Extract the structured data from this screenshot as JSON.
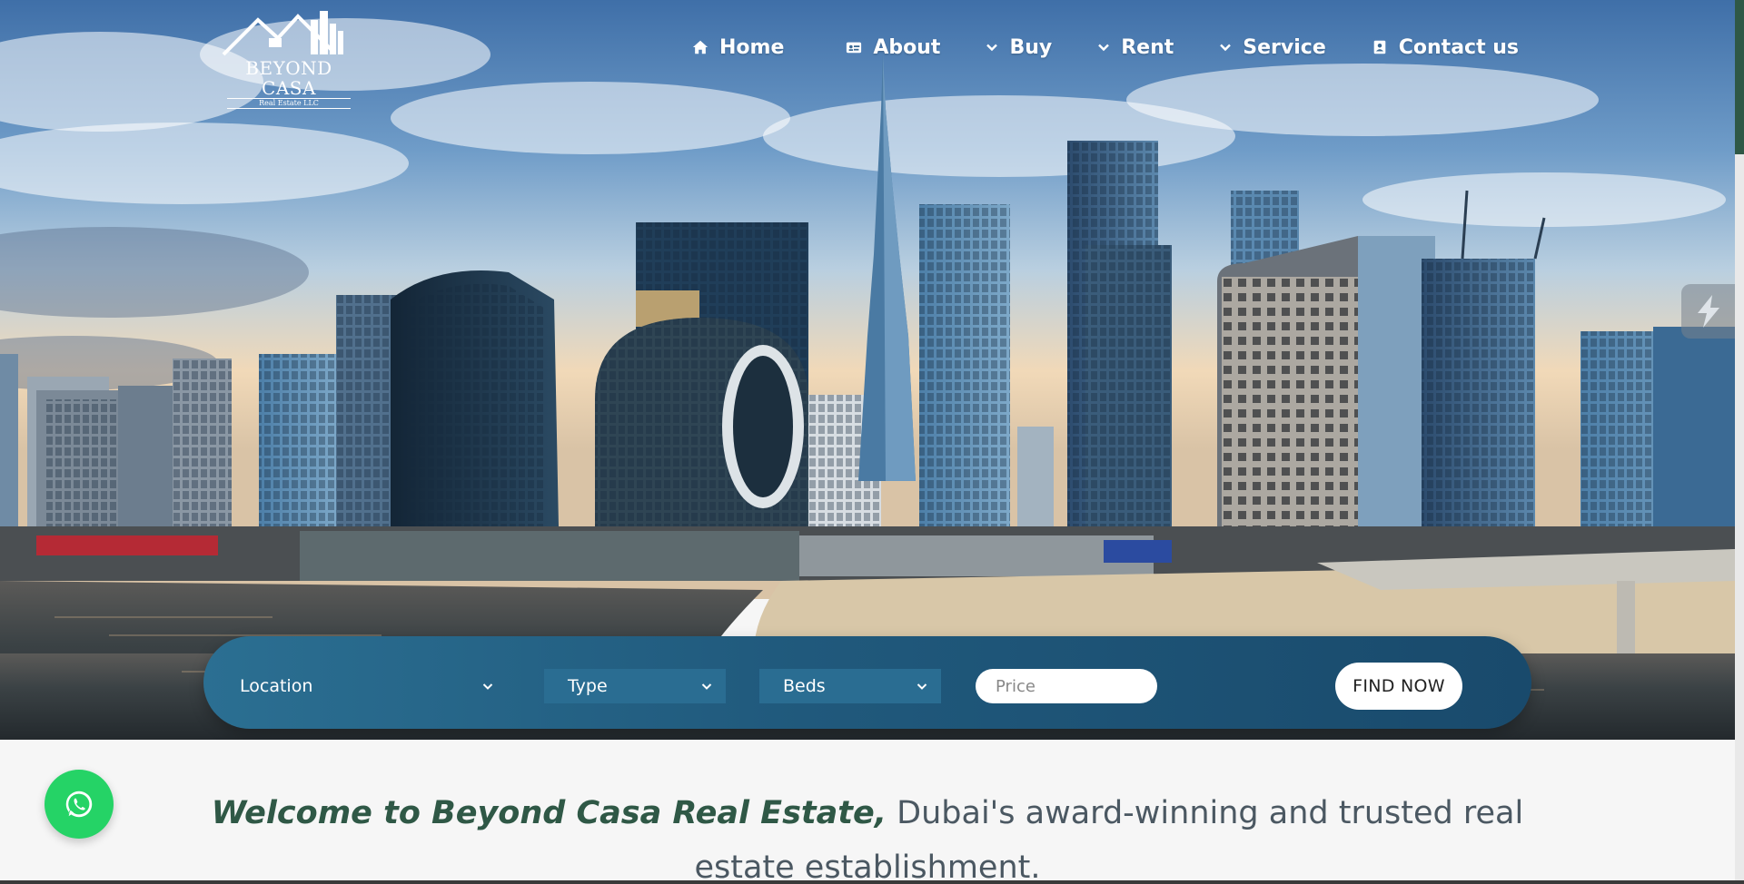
{
  "brand": {
    "name": "BEYOND CASA",
    "tagline": "Real Estate LLC",
    "logo_icon": "house-skyline-logo"
  },
  "nav": {
    "items": [
      {
        "label": "Home",
        "icon": "home-icon"
      },
      {
        "label": "About",
        "icon": "id-card-icon"
      },
      {
        "label": "Buy",
        "icon": "chevron-down-icon"
      },
      {
        "label": "Rent",
        "icon": "chevron-down-icon"
      },
      {
        "label": "Service",
        "icon": "chevron-down-icon"
      },
      {
        "label": "Contact us",
        "icon": "address-book-icon"
      }
    ]
  },
  "search": {
    "location_label": "Location",
    "type_label": "Type",
    "beds_label": "Beds",
    "price_placeholder": "Price",
    "find_label": "FIND NOW"
  },
  "welcome": {
    "strong": "Welcome to Beyond Casa Real Estate,",
    "rest": " Dubai's award-winning and trusted real estate establishment."
  },
  "colors": {
    "brand_green": "#2f5846",
    "search_bar": "#20597c",
    "whatsapp": "#25d366"
  }
}
